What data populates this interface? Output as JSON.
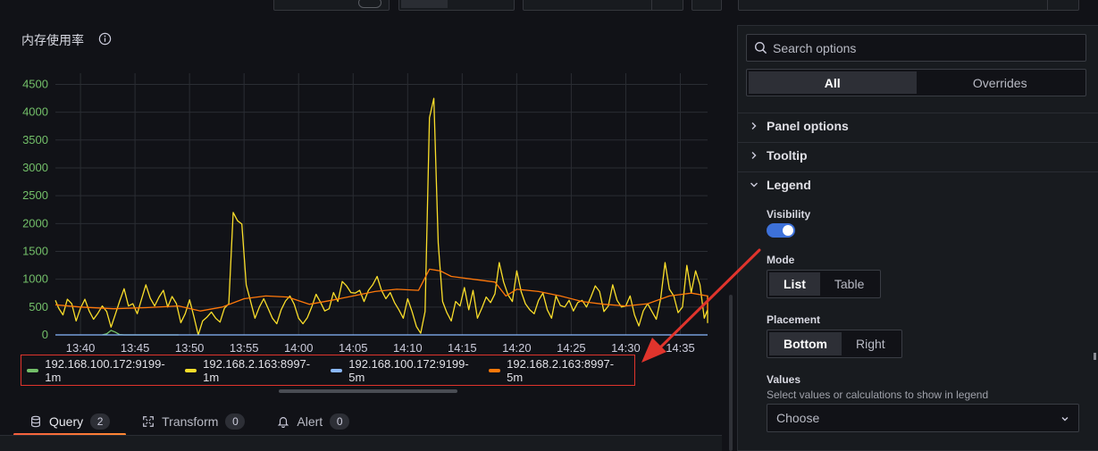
{
  "panel": {
    "title": "内存使用率"
  },
  "chart_data": {
    "type": "line",
    "x_ticks": [
      "13:40",
      "13:45",
      "13:50",
      "13:55",
      "14:00",
      "14:05",
      "14:10",
      "14:15",
      "14:20",
      "14:25",
      "14:30",
      "14:35"
    ],
    "y_ticks": [
      "0",
      "500",
      "1000",
      "1500",
      "2000",
      "2500",
      "3000",
      "3500",
      "4000",
      "4500"
    ],
    "ylim": [
      0,
      4700
    ],
    "xlim_minutes": [
      -2.3,
      57.5
    ],
    "grid": true,
    "legend_placement": "bottom",
    "series": [
      {
        "name": "192.168.100.172:9199-1m",
        "color": "#73bf69",
        "points": [
          [
            2.0,
            0
          ],
          [
            2.4,
            20
          ],
          [
            2.8,
            80
          ],
          [
            3.2,
            50
          ],
          [
            3.6,
            5
          ],
          [
            4.0,
            0
          ],
          [
            9,
            0
          ]
        ]
      },
      {
        "name": "192.168.2.163:8997-1m",
        "color": "#fade2a",
        "points": [
          [
            -2.3,
            620
          ],
          [
            -2.0,
            480
          ],
          [
            -1.6,
            360
          ],
          [
            -1.2,
            640
          ],
          [
            -0.8,
            560
          ],
          [
            -0.4,
            250
          ],
          [
            0,
            480
          ],
          [
            0.4,
            640
          ],
          [
            0.8,
            430
          ],
          [
            1.2,
            280
          ],
          [
            1.6,
            390
          ],
          [
            2.0,
            520
          ],
          [
            2.4,
            420
          ],
          [
            2.8,
            140
          ],
          [
            3.2,
            370
          ],
          [
            3.6,
            610
          ],
          [
            4.0,
            830
          ],
          [
            4.4,
            520
          ],
          [
            4.8,
            560
          ],
          [
            5.2,
            380
          ],
          [
            5.6,
            640
          ],
          [
            6.0,
            900
          ],
          [
            6.4,
            660
          ],
          [
            6.8,
            520
          ],
          [
            7.2,
            680
          ],
          [
            7.6,
            800
          ],
          [
            8.0,
            500
          ],
          [
            8.4,
            690
          ],
          [
            8.8,
            560
          ],
          [
            9.2,
            220
          ],
          [
            9.6,
            380
          ],
          [
            10.0,
            630
          ],
          [
            10.4,
            330
          ],
          [
            10.8,
            0
          ],
          [
            11.2,
            250
          ],
          [
            11.6,
            320
          ],
          [
            12.0,
            410
          ],
          [
            12.4,
            300
          ],
          [
            12.8,
            230
          ],
          [
            13.2,
            480
          ],
          [
            13.6,
            560
          ],
          [
            14.0,
            2200
          ],
          [
            14.4,
            2050
          ],
          [
            14.8,
            1990
          ],
          [
            15.2,
            900
          ],
          [
            15.6,
            600
          ],
          [
            16.0,
            300
          ],
          [
            16.4,
            500
          ],
          [
            16.8,
            650
          ],
          [
            17.2,
            480
          ],
          [
            17.6,
            300
          ],
          [
            18.0,
            200
          ],
          [
            18.4,
            450
          ],
          [
            18.8,
            610
          ],
          [
            19.2,
            700
          ],
          [
            19.6,
            550
          ],
          [
            20.0,
            300
          ],
          [
            20.4,
            200
          ],
          [
            20.8,
            310
          ],
          [
            21.2,
            500
          ],
          [
            21.6,
            730
          ],
          [
            22.0,
            590
          ],
          [
            22.4,
            430
          ],
          [
            22.8,
            470
          ],
          [
            23.2,
            760
          ],
          [
            23.6,
            600
          ],
          [
            24.0,
            960
          ],
          [
            24.4,
            880
          ],
          [
            24.8,
            760
          ],
          [
            25.2,
            750
          ],
          [
            25.6,
            800
          ],
          [
            26.0,
            600
          ],
          [
            26.4,
            800
          ],
          [
            26.8,
            900
          ],
          [
            27.2,
            1050
          ],
          [
            27.6,
            800
          ],
          [
            28.0,
            650
          ],
          [
            28.4,
            760
          ],
          [
            28.8,
            580
          ],
          [
            29.2,
            450
          ],
          [
            29.6,
            300
          ],
          [
            30.0,
            650
          ],
          [
            30.4,
            420
          ],
          [
            30.8,
            150
          ],
          [
            31.2,
            30
          ],
          [
            31.6,
            420
          ],
          [
            32.0,
            3900
          ],
          [
            32.4,
            4250
          ],
          [
            32.8,
            1650
          ],
          [
            33.2,
            600
          ],
          [
            33.6,
            400
          ],
          [
            34.0,
            250
          ],
          [
            34.4,
            600
          ],
          [
            34.8,
            520
          ],
          [
            35.2,
            850
          ],
          [
            35.6,
            450
          ],
          [
            36.0,
            800
          ],
          [
            36.4,
            300
          ],
          [
            36.8,
            480
          ],
          [
            37.2,
            680
          ],
          [
            37.6,
            580
          ],
          [
            38.0,
            740
          ],
          [
            38.4,
            1300
          ],
          [
            38.8,
            950
          ],
          [
            39.2,
            720
          ],
          [
            39.6,
            600
          ],
          [
            40.0,
            1150
          ],
          [
            40.4,
            780
          ],
          [
            40.8,
            560
          ],
          [
            41.2,
            450
          ],
          [
            41.6,
            380
          ],
          [
            42.0,
            620
          ],
          [
            42.4,
            750
          ],
          [
            42.8,
            450
          ],
          [
            43.2,
            300
          ],
          [
            43.6,
            700
          ],
          [
            44.0,
            530
          ],
          [
            44.4,
            500
          ],
          [
            44.8,
            620
          ],
          [
            45.2,
            430
          ],
          [
            45.6,
            580
          ],
          [
            46.0,
            620
          ],
          [
            46.4,
            500
          ],
          [
            46.8,
            680
          ],
          [
            47.2,
            880
          ],
          [
            47.6,
            780
          ],
          [
            48.0,
            420
          ],
          [
            48.4,
            520
          ],
          [
            48.8,
            900
          ],
          [
            49.2,
            620
          ],
          [
            49.6,
            500
          ],
          [
            50.0,
            520
          ],
          [
            50.4,
            700
          ],
          [
            50.8,
            360
          ],
          [
            51.2,
            160
          ],
          [
            51.6,
            430
          ],
          [
            52.0,
            560
          ],
          [
            52.4,
            420
          ],
          [
            52.8,
            280
          ],
          [
            53.2,
            650
          ],
          [
            53.6,
            1300
          ],
          [
            54.0,
            820
          ],
          [
            54.4,
            700
          ],
          [
            54.8,
            400
          ],
          [
            55.2,
            500
          ],
          [
            55.6,
            1250
          ],
          [
            56.0,
            760
          ],
          [
            56.4,
            1150
          ],
          [
            56.8,
            900
          ],
          [
            57.2,
            300
          ],
          [
            57.5,
            450
          ],
          [
            58.0,
            370
          ],
          [
            58.4,
            620
          ],
          [
            58.8,
            300
          ],
          [
            59.2,
            560
          ],
          [
            59.6,
            480
          ],
          [
            60.0,
            700
          ],
          [
            60.4,
            340
          ],
          [
            60.8,
            430
          ],
          [
            61.2,
            650
          ],
          [
            61.6,
            540
          ],
          [
            62.0,
            360
          ],
          [
            62.4,
            250
          ],
          [
            62.8,
            500
          ],
          [
            63.2,
            400
          ],
          [
            63.6,
            560
          ],
          [
            64.0,
            300
          ],
          [
            64.4,
            550
          ],
          [
            64.8,
            220
          ],
          [
            65.2,
            600
          ],
          [
            65.6,
            700
          ],
          [
            66.0,
            450
          ],
          [
            66.4,
            380
          ],
          [
            66.8,
            280
          ],
          [
            67.2,
            600
          ],
          [
            67.6,
            380
          ],
          [
            68.0,
            450
          ],
          [
            68.4,
            650
          ],
          [
            68.8,
            500
          ],
          [
            69.2,
            420
          ],
          [
            69.6,
            600
          ],
          [
            70.0,
            380
          ],
          [
            70.4,
            350
          ],
          [
            70.8,
            470
          ],
          [
            71.2,
            550
          ],
          [
            71.6,
            500
          ],
          [
            72.0,
            380
          ],
          [
            72.4,
            600
          ],
          [
            72.8,
            450
          ],
          [
            73.2,
            500
          ],
          [
            73.6,
            320
          ],
          [
            74.0,
            380
          ],
          [
            74.4,
            360
          ],
          [
            74.8,
            370
          ]
        ]
      },
      {
        "name": "192.168.100.172:9199-5m",
        "color": "#8ab8ff",
        "points": [
          [
            -2.3,
            0
          ],
          [
            74.8,
            0
          ]
        ]
      },
      {
        "name": "192.168.2.163:8997-5m",
        "color": "#ff780a",
        "points": [
          [
            -2.3,
            540
          ],
          [
            0,
            500
          ],
          [
            3,
            470
          ],
          [
            6,
            490
          ],
          [
            9,
            520
          ],
          [
            11,
            430
          ],
          [
            13,
            500
          ],
          [
            15,
            650
          ],
          [
            17,
            700
          ],
          [
            19,
            680
          ],
          [
            21,
            550
          ],
          [
            23,
            620
          ],
          [
            25,
            700
          ],
          [
            27,
            780
          ],
          [
            29,
            820
          ],
          [
            31,
            800
          ],
          [
            32,
            1180
          ],
          [
            33,
            1150
          ],
          [
            34,
            1050
          ],
          [
            36,
            1000
          ],
          [
            38,
            950
          ],
          [
            39,
            700
          ],
          [
            40,
            820
          ],
          [
            42,
            780
          ],
          [
            44,
            700
          ],
          [
            46,
            600
          ],
          [
            48,
            550
          ],
          [
            50,
            520
          ],
          [
            52,
            560
          ],
          [
            54,
            700
          ],
          [
            56,
            750
          ],
          [
            58,
            700
          ],
          [
            60,
            600
          ],
          [
            62,
            560
          ],
          [
            64,
            450
          ],
          [
            66,
            480
          ],
          [
            68,
            520
          ],
          [
            70,
            550
          ],
          [
            72,
            490
          ],
          [
            74,
            520
          ],
          [
            74.8,
            500
          ]
        ]
      }
    ]
  },
  "legend": {
    "items": [
      {
        "label": "192.168.100.172:9199-1m",
        "color": "#73bf69"
      },
      {
        "label": "192.168.2.163:8997-1m",
        "color": "#fade2a"
      },
      {
        "label": "192.168.100.172:9199-5m",
        "color": "#8ab8ff"
      },
      {
        "label": "192.168.2.163:8997-5m",
        "color": "#ff780a"
      }
    ]
  },
  "tabs": [
    {
      "label": "Query",
      "count": "2",
      "icon": "database-icon"
    },
    {
      "label": "Transform",
      "count": "0",
      "icon": "transform-icon"
    },
    {
      "label": "Alert",
      "count": "0",
      "icon": "bell-icon"
    }
  ],
  "options": {
    "search_placeholder": "Search options",
    "seg_all": "All",
    "seg_overrides": "Overrides",
    "sections": {
      "panel_options": "Panel options",
      "tooltip": "Tooltip",
      "legend": "Legend"
    },
    "visibility_label": "Visibility",
    "visibility_on": true,
    "mode_label": "Mode",
    "mode_list": "List",
    "mode_table": "Table",
    "placement_label": "Placement",
    "placement_bottom": "Bottom",
    "placement_right": "Right",
    "values_label": "Values",
    "values_desc": "Select values or calculations to show in legend",
    "values_choose": "Choose"
  },
  "colors": {
    "accent_blue": "#3d71d9",
    "annotation_red": "#e0342c"
  }
}
